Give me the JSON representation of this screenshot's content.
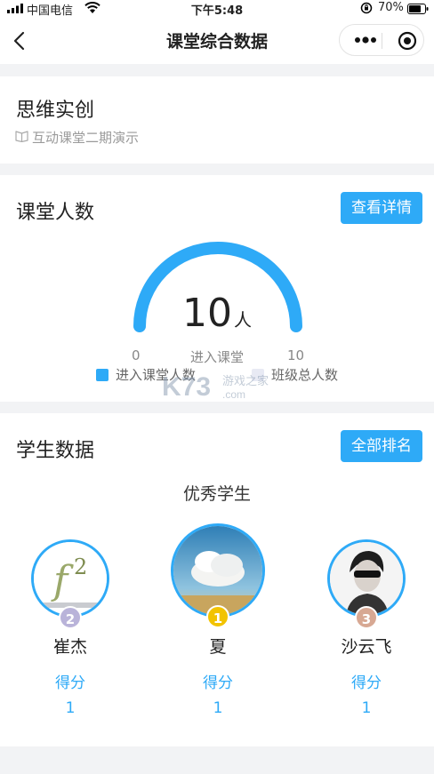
{
  "status_bar": {
    "carrier": "中国电信",
    "time": "下午5:48",
    "battery": "70%"
  },
  "nav": {
    "title": "课堂综合数据"
  },
  "course": {
    "name": "思维实创",
    "subtitle": "互动课堂二期演示"
  },
  "classroom": {
    "title": "课堂人数",
    "details_button": "查看详情",
    "value": "10",
    "unit": "人",
    "min": "0",
    "max": "10",
    "center_label": "进入课堂",
    "fill_ratio": 1.0,
    "legend": [
      {
        "label": "进入课堂人数",
        "color": "#2eaaf7"
      },
      {
        "label": "班级总人数",
        "color": "#e8eaf4"
      }
    ]
  },
  "students": {
    "title": "学生数据",
    "ranking_button": "全部排名",
    "excellent_label": "优秀学生",
    "top": [
      {
        "rank": "2",
        "name": "崔杰",
        "score_label": "得分",
        "score": "1",
        "medal_color": "#b9b3d9"
      },
      {
        "rank": "1",
        "name": "夏",
        "score_label": "得分",
        "score": "1",
        "medal_color": "#f2c300"
      },
      {
        "rank": "3",
        "name": "沙云飞",
        "score_label": "得分",
        "score": "1",
        "medal_color": "#d7a893"
      }
    ]
  },
  "watermark": {
    "brand": "K73",
    "text": "游戏之家",
    "domain": ".com"
  },
  "colors": {
    "accent": "#2eaaf7",
    "background": "#f2f3f5"
  }
}
